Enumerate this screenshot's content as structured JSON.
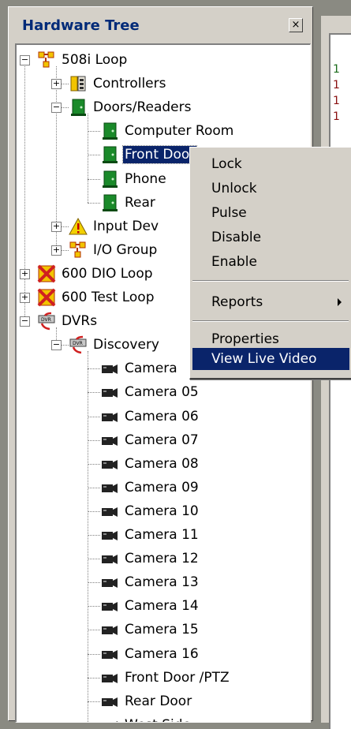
{
  "window": {
    "title": "Hardware Tree",
    "close_glyph": "×"
  },
  "tree": [
    {
      "label": "508i Loop",
      "icon": "loop-icon",
      "expander": "−",
      "selected": false
    },
    {
      "label": "Controllers",
      "icon": "controller-icon",
      "expander": "+",
      "selected": false
    },
    {
      "label": "Doors/Readers",
      "icon": "door-icon",
      "expander": "−",
      "selected": false
    },
    {
      "label": "Computer Room",
      "icon": "door-icon",
      "expander": "",
      "selected": false
    },
    {
      "label": "Front Door",
      "icon": "door-icon",
      "expander": "",
      "selected": true
    },
    {
      "label": "Phone",
      "icon": "door-icon",
      "expander": "",
      "selected": false
    },
    {
      "label": "Rear",
      "icon": "door-icon",
      "expander": "",
      "selected": false
    },
    {
      "label": "Input Dev",
      "icon": "warning-icon",
      "expander": "+",
      "selected": false
    },
    {
      "label": "I/O Group",
      "icon": "loop-icon",
      "expander": "+",
      "selected": false
    },
    {
      "label": "600 DIO Loop",
      "icon": "offline-loop-icon",
      "expander": "+",
      "selected": false
    },
    {
      "label": "600 Test Loop",
      "icon": "offline-loop-icon",
      "expander": "+",
      "selected": false
    },
    {
      "label": "DVRs",
      "icon": "dvr-icon",
      "expander": "−",
      "selected": false
    },
    {
      "label": "Discovery",
      "icon": "dvr-icon",
      "expander": "−",
      "selected": false
    },
    {
      "label": "Camera",
      "icon": "camera-icon",
      "expander": "",
      "selected": false
    },
    {
      "label": "Camera 05",
      "icon": "camera-icon",
      "expander": "",
      "selected": false
    },
    {
      "label": "Camera 06",
      "icon": "camera-icon",
      "expander": "",
      "selected": false
    },
    {
      "label": "Camera 07",
      "icon": "camera-icon",
      "expander": "",
      "selected": false
    },
    {
      "label": "Camera 08",
      "icon": "camera-icon",
      "expander": "",
      "selected": false
    },
    {
      "label": "Camera 09",
      "icon": "camera-icon",
      "expander": "",
      "selected": false
    },
    {
      "label": "Camera 10",
      "icon": "camera-icon",
      "expander": "",
      "selected": false
    },
    {
      "label": "Camera 11",
      "icon": "camera-icon",
      "expander": "",
      "selected": false
    },
    {
      "label": "Camera 12",
      "icon": "camera-icon",
      "expander": "",
      "selected": false
    },
    {
      "label": "Camera 13",
      "icon": "camera-icon",
      "expander": "",
      "selected": false
    },
    {
      "label": "Camera 14",
      "icon": "camera-icon",
      "expander": "",
      "selected": false
    },
    {
      "label": "Camera 15",
      "icon": "camera-icon",
      "expander": "",
      "selected": false
    },
    {
      "label": "Camera 16",
      "icon": "camera-icon",
      "expander": "",
      "selected": false
    },
    {
      "label": "Front Door /PTZ",
      "icon": "camera-icon",
      "expander": "",
      "selected": false
    },
    {
      "label": "Rear Door",
      "icon": "camera-icon",
      "expander": "",
      "selected": false
    },
    {
      "label": "West Side",
      "icon": "camera-icon",
      "expander": "",
      "selected": false
    }
  ],
  "context_menu": {
    "items": [
      {
        "label": "Lock",
        "highlighted": false,
        "submenu": false
      },
      {
        "label": "Unlock",
        "highlighted": false,
        "submenu": false
      },
      {
        "label": "Pulse",
        "highlighted": false,
        "submenu": false
      },
      {
        "label": "Disable",
        "highlighted": false,
        "submenu": false
      },
      {
        "label": "Enable",
        "highlighted": false,
        "submenu": false
      },
      {
        "label": "Reports",
        "highlighted": false,
        "submenu": true
      },
      {
        "label": "Properties",
        "highlighted": false,
        "submenu": false
      },
      {
        "label": "View Live Video",
        "highlighted": true,
        "submenu": false
      }
    ]
  },
  "right_pane": {
    "row_marks": [
      "1",
      "1",
      "1",
      "1"
    ]
  },
  "colors": {
    "selection": "#0a246a",
    "title_text": "#002a78",
    "door_green": "#1a8a2a",
    "camera_dark": "#222222",
    "offline_red": "#d02020"
  }
}
